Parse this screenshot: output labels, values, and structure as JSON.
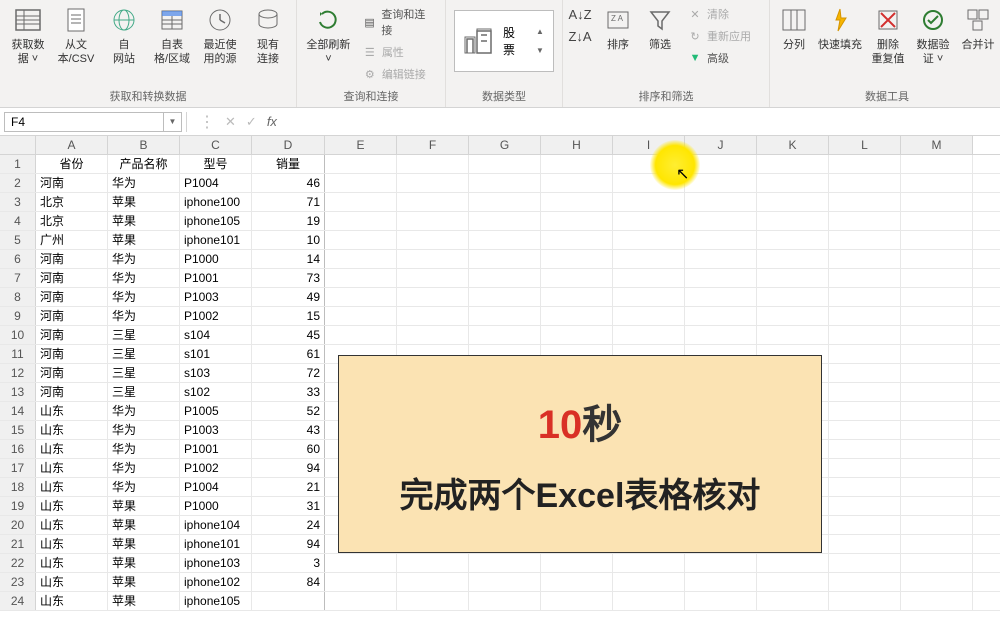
{
  "ribbon": {
    "groups": {
      "get_transform": {
        "label": "获取和转换数据",
        "get_data": "获取数\n据 ˅",
        "from_csv": "从文\n本/CSV",
        "from_web": "自\n网站",
        "from_table": "自表\n格/区域",
        "recent": "最近使\n用的源",
        "existing": "现有\n连接"
      },
      "queries": {
        "label": "查询和连接",
        "refresh_all": "全部刷新\n˅",
        "queries_connections": "查询和连接",
        "properties": "属性",
        "edit_links": "编辑链接"
      },
      "data_types": {
        "label": "数据类型",
        "stock": "股票"
      },
      "sort_filter": {
        "label": "排序和筛选",
        "sort": "排序",
        "filter": "筛选",
        "clear": "清除",
        "reapply": "重新应用",
        "advanced": "高级"
      },
      "data_tools": {
        "label": "数据工具",
        "text_to_col": "分列",
        "flash_fill": "快速填充",
        "remove_dup": "删除\n重复值",
        "data_val": "数据验\n证 ˅",
        "consolidate": "合并计"
      }
    }
  },
  "formula_bar": {
    "cell_ref": "F4",
    "formula": ""
  },
  "columns": [
    "A",
    "B",
    "C",
    "D",
    "E",
    "F",
    "G",
    "H",
    "I",
    "J",
    "K",
    "L",
    "M"
  ],
  "headers": [
    "省份",
    "产品名称",
    "型号",
    "销量"
  ],
  "rows": [
    {
      "p": "河南",
      "n": "华为",
      "m": "P1004",
      "s": "46"
    },
    {
      "p": "北京",
      "n": "苹果",
      "m": "iphone100",
      "s": "71"
    },
    {
      "p": "北京",
      "n": "苹果",
      "m": "iphone105",
      "s": "19"
    },
    {
      "p": "广州",
      "n": "苹果",
      "m": "iphone101",
      "s": "10"
    },
    {
      "p": "河南",
      "n": "华为",
      "m": "P1000",
      "s": "14"
    },
    {
      "p": "河南",
      "n": "华为",
      "m": "P1001",
      "s": "73"
    },
    {
      "p": "河南",
      "n": "华为",
      "m": "P1003",
      "s": "49"
    },
    {
      "p": "河南",
      "n": "华为",
      "m": "P1002",
      "s": "15"
    },
    {
      "p": "河南",
      "n": "三星",
      "m": "s104",
      "s": "45"
    },
    {
      "p": "河南",
      "n": "三星",
      "m": "s101",
      "s": "61"
    },
    {
      "p": "河南",
      "n": "三星",
      "m": "s103",
      "s": "72"
    },
    {
      "p": "河南",
      "n": "三星",
      "m": "s102",
      "s": "33"
    },
    {
      "p": "山东",
      "n": "华为",
      "m": "P1005",
      "s": "52"
    },
    {
      "p": "山东",
      "n": "华为",
      "m": "P1003",
      "s": "43"
    },
    {
      "p": "山东",
      "n": "华为",
      "m": "P1001",
      "s": "60"
    },
    {
      "p": "山东",
      "n": "华为",
      "m": "P1002",
      "s": "94"
    },
    {
      "p": "山东",
      "n": "华为",
      "m": "P1004",
      "s": "21"
    },
    {
      "p": "山东",
      "n": "苹果",
      "m": "P1000",
      "s": "31"
    },
    {
      "p": "山东",
      "n": "苹果",
      "m": "iphone104",
      "s": "24"
    },
    {
      "p": "山东",
      "n": "苹果",
      "m": "iphone101",
      "s": "94"
    },
    {
      "p": "山东",
      "n": "苹果",
      "m": "iphone103",
      "s": "3"
    },
    {
      "p": "山东",
      "n": "苹果",
      "m": "iphone102",
      "s": "84"
    },
    {
      "p": "山东",
      "n": "苹果",
      "m": "iphone105",
      "s": ""
    }
  ],
  "overlay": {
    "num": "10",
    "unit": "秒",
    "line2": "完成两个Excel表格核对"
  }
}
